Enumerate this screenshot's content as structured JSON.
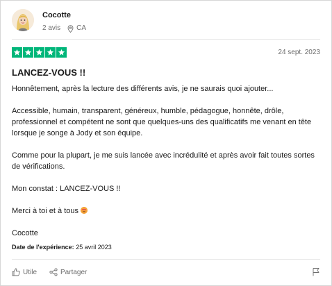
{
  "reviewer": {
    "name": "Cocotte",
    "reviews_count": "2 avis",
    "country": "CA"
  },
  "review": {
    "rating": 5,
    "date": "24 sept. 2023",
    "title": "LANCEZ-VOUS !!",
    "paragraphs": [
      "Honnêtement, après la lecture des différents avis, je ne saurais quoi ajouter...",
      "Accessible, humain, transparent, généreux, humble, pédagogue, honnête, drôle, professionnel et compétent ne sont que quelques-uns des qualificatifs me venant en tête lorsque je songe à Jody et son équipe.",
      "Comme pour la plupart, je me suis lancée avec incrédulité et après avoir fait toutes sortes de vérifications.",
      "Mon constat : LANCEZ-VOUS !!",
      "Merci à toi et à tous",
      "Cocotte"
    ],
    "experience_label": "Date de l'expérience:",
    "experience_date": "25 avril 2023"
  },
  "actions": {
    "useful_label": "Utile",
    "share_label": "Partager"
  },
  "colors": {
    "star_green": "#00b67a",
    "muted_text": "#6c6c6c"
  },
  "icons": [
    "avatar",
    "location-pin-icon",
    "star-icon",
    "thumbs-up-icon",
    "share-icon",
    "flag-icon",
    "heart-eyes-emoji"
  ]
}
